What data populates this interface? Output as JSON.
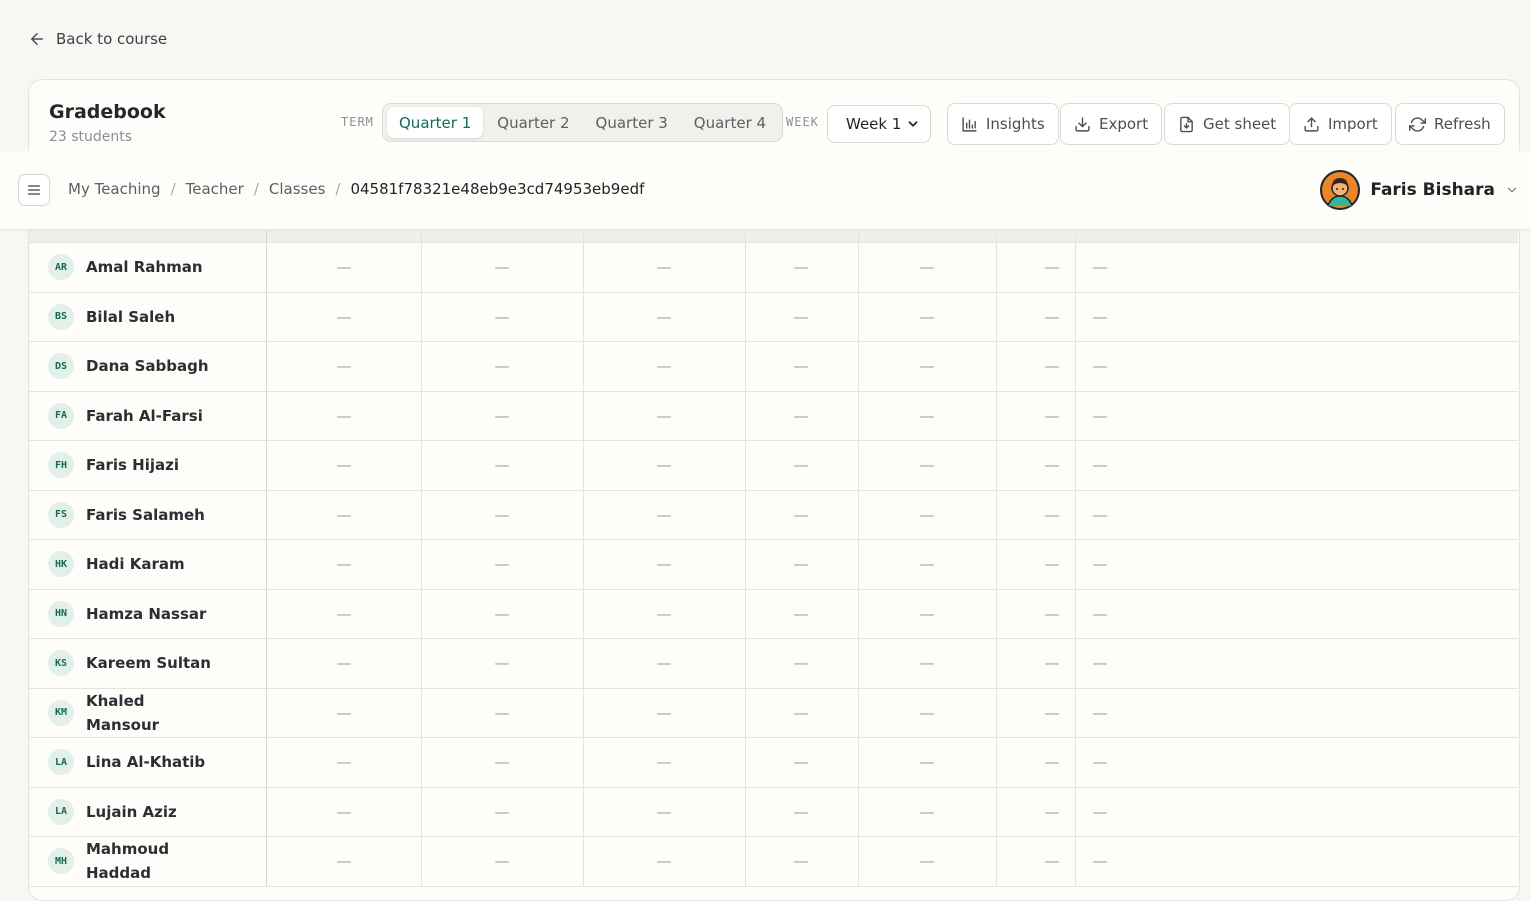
{
  "back": {
    "label": "Back to course"
  },
  "gradebook": {
    "title": "Gradebook",
    "subtitle": "23 students"
  },
  "term": {
    "label": "TERM",
    "options": [
      "Quarter 1",
      "Quarter 2",
      "Quarter 3",
      "Quarter 4"
    ],
    "active": "Quarter 1"
  },
  "week": {
    "label": "WEEK",
    "value": "Week 1"
  },
  "toolbar": {
    "insights": "Insights",
    "export": "Export",
    "get_sheet": "Get sheet",
    "import": "Import",
    "refresh": "Refresh"
  },
  "breadcrumb": [
    "My Teaching",
    "Teacher",
    "Classes",
    "04581f78321e48eb9e3cd74953eb9edf"
  ],
  "user": {
    "name": "Faris Bishara"
  },
  "empty_value": "—",
  "students": [
    {
      "initials": "AR",
      "name": "Amal Rahman"
    },
    {
      "initials": "BS",
      "name": "Bilal Saleh"
    },
    {
      "initials": "DS",
      "name": "Dana Sabbagh"
    },
    {
      "initials": "FA",
      "name": "Farah Al-Farsi"
    },
    {
      "initials": "FH",
      "name": "Faris Hijazi"
    },
    {
      "initials": "FS",
      "name": "Faris Salameh"
    },
    {
      "initials": "HK",
      "name": "Hadi Karam"
    },
    {
      "initials": "HN",
      "name": "Hamza Nassar"
    },
    {
      "initials": "KS",
      "name": "Kareem Sultan"
    },
    {
      "initials": "KM",
      "name": "Khaled Mansour"
    },
    {
      "initials": "LA",
      "name": "Lina Al-Khatib"
    },
    {
      "initials": "LA",
      "name": "Lujain Aziz"
    },
    {
      "initials": "MH",
      "name": "Mahmoud Haddad"
    }
  ]
}
